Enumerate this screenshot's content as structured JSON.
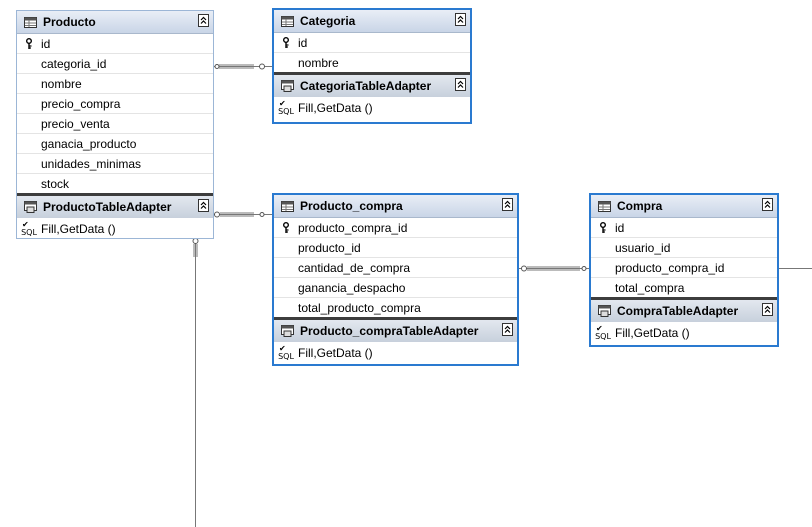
{
  "tables": {
    "producto": {
      "title": "Producto",
      "columns": [
        "id",
        "categoria_id",
        "nombre",
        "precio_compra",
        "precio_venta",
        "ganacia_producto",
        "unidades_minimas",
        "stock"
      ],
      "adapter": "ProductoTableAdapter",
      "query": "Fill,GetData ()"
    },
    "categoria": {
      "title": "Categoria",
      "columns": [
        "id",
        "nombre"
      ],
      "adapter": "CategoriaTableAdapter",
      "query": "Fill,GetData ()"
    },
    "producto_compra": {
      "title": "Producto_compra",
      "columns": [
        "producto_compra_id",
        "producto_id",
        "cantidad_de_compra",
        "ganancia_despacho",
        "total_producto_compra"
      ],
      "adapter": "Producto_compraTableAdapter",
      "query": "Fill,GetData ()"
    },
    "compra": {
      "title": "Compra",
      "columns": [
        "id",
        "usuario_id",
        "producto_compra_id",
        "total_compra"
      ],
      "adapter": "CompraTableAdapter",
      "query": "Fill,GetData ()"
    }
  },
  "sql_label": "SQL",
  "colors": {
    "selected_border": "#2a7ad0",
    "unselected_border": "#9cb6d6",
    "header_bg": "#c9d5e7"
  },
  "icons": {
    "table": "table-icon",
    "key": "key-icon",
    "adapter": "table-adapter-icon",
    "collapse": "collapse-icon",
    "query": "sql-query-icon"
  }
}
